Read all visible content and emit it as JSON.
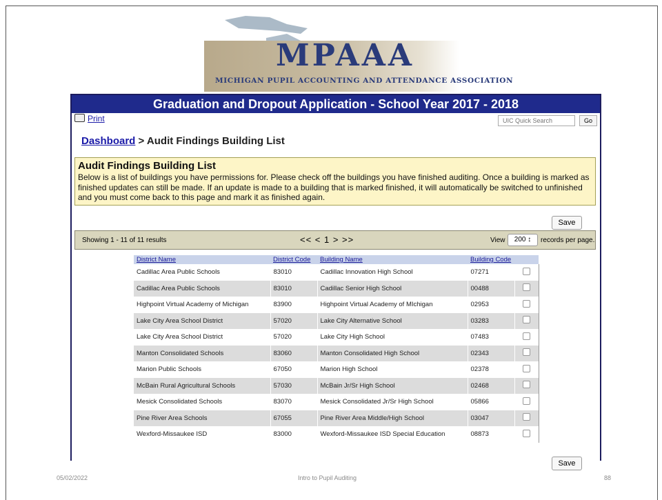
{
  "logo": {
    "title": "MPAAA",
    "subtitle": "MICHIGAN PUPIL ACCOUNTING AND ATTENDANCE ASSOCIATION"
  },
  "app": {
    "header": "Graduation and Dropout Application - School Year 2017 - 2018",
    "print_label": "Print",
    "uic_placeholder": "UIC Quick Search",
    "go_label": "Go",
    "breadcrumb": {
      "link": "Dashboard",
      "separator": " > ",
      "current": "Audit Findings Building List"
    },
    "info": {
      "title": "Audit Findings Building List",
      "text": "Below is a list of buildings you have permissions for. Please check off the buildings you have finished auditing. Once a building is marked as finished updates can still be made. If an update is made to a building that is marked finished, it will automatically be switched to unfinished and you must come back to this page and mark it as finished again."
    },
    "save_label": "Save",
    "pager": {
      "showing": "Showing 1 - 11 of 11 results",
      "nav": "<< < 1 > >>",
      "view_label": "View",
      "per_page": "200 ↕",
      "per_page_suffix": "records per page."
    },
    "table": {
      "headers": [
        "District Name",
        "District Code",
        "Building Name",
        "Building Code"
      ],
      "rows": [
        {
          "district": "Cadillac Area Public Schools",
          "dcode": "83010",
          "building": "Cadillac Innovation High School",
          "bcode": "07271"
        },
        {
          "district": "Cadillac Area Public Schools",
          "dcode": "83010",
          "building": "Cadillac Senior High School",
          "bcode": "00488"
        },
        {
          "district": "Highpoint Virtual Academy of Michigan",
          "dcode": "83900",
          "building": "Highpoint Virtual Academy of MIchigan",
          "bcode": "02953"
        },
        {
          "district": "Lake City Area School District",
          "dcode": "57020",
          "building": "Lake City Alternative School",
          "bcode": "03283"
        },
        {
          "district": "Lake City Area School District",
          "dcode": "57020",
          "building": "Lake City High School",
          "bcode": "07483"
        },
        {
          "district": "Manton Consolidated Schools",
          "dcode": "83060",
          "building": "Manton Consolidated High School",
          "bcode": "02343"
        },
        {
          "district": "Marion Public Schools",
          "dcode": "67050",
          "building": "Marion High School",
          "bcode": "02378"
        },
        {
          "district": "McBain Rural Agricultural Schools",
          "dcode": "57030",
          "building": "McBain Jr/Sr High School",
          "bcode": "02468"
        },
        {
          "district": "Mesick Consolidated Schools",
          "dcode": "83070",
          "building": "Mesick Consolidated Jr/Sr High School",
          "bcode": "05866"
        },
        {
          "district": "Pine River Area Schools",
          "dcode": "67055",
          "building": "Pine River Area Middle/High School",
          "bcode": "03047"
        },
        {
          "district": "Wexford-Missaukee ISD",
          "dcode": "83000",
          "building": "Wexford-Missaukee ISD Special Education",
          "bcode": "08873"
        }
      ]
    }
  },
  "footer": {
    "date": "05/02/2022",
    "title": "Intro to Pupil Auditing",
    "page": "88"
  },
  "colors": {
    "header_bg": "#1f2a8c",
    "info_bg": "#fdf5c7",
    "pager_bg": "#d9d6bd",
    "row_alt": "#dcdcdc"
  }
}
